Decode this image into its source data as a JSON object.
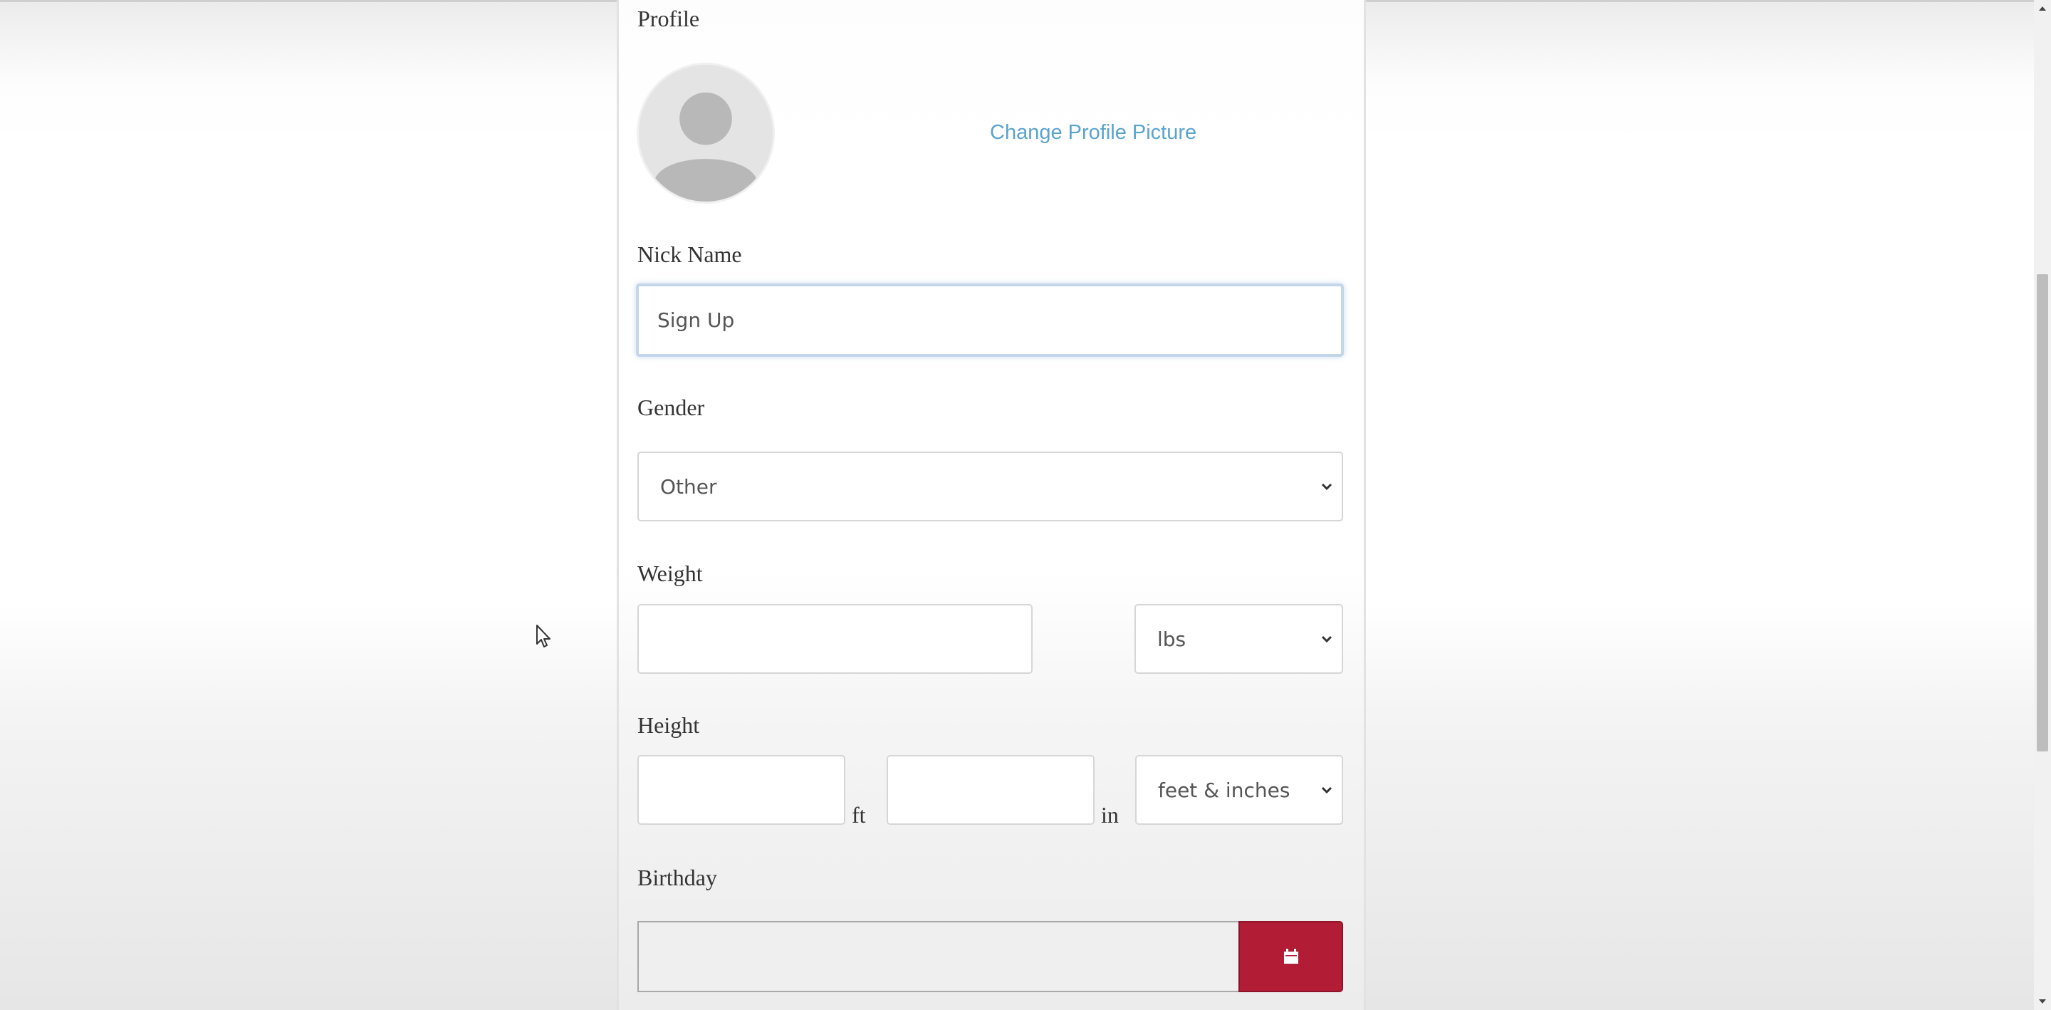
{
  "profile_section": {
    "title": "Profile",
    "avatar_icon": "default-user-avatar",
    "change_picture_label": "Change Profile Picture"
  },
  "nick_name": {
    "label": "Nick Name",
    "value": "Sign Up"
  },
  "gender": {
    "label": "Gender",
    "selected": "Other"
  },
  "weight": {
    "label": "Weight",
    "value": "",
    "unit_selected": "lbs"
  },
  "height": {
    "label": "Height",
    "feet_value": "",
    "feet_unit": "ft",
    "inches_value": "",
    "inches_unit": "in",
    "unit_selected": "feet & inches"
  },
  "birthday": {
    "label": "Birthday",
    "value": "",
    "calendar_icon": "calendar-icon"
  },
  "colors": {
    "accent_link": "#5aa3cf",
    "calendar_button": "#b21d35",
    "focus_border": "#c3d6ea"
  }
}
